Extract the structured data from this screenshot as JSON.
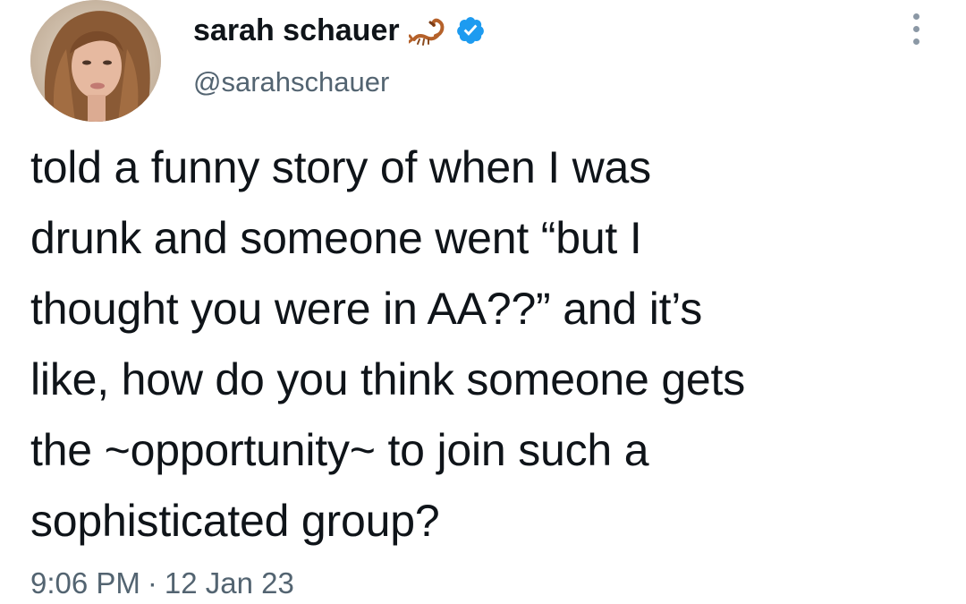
{
  "author": {
    "display_name": "sarah schauer",
    "handle": "@sarahschauer",
    "name_emoji": "scorpion-icon",
    "verified": true,
    "verified_color": "#1d9bf0"
  },
  "tweet": {
    "lines": [
      "told a funny story of when I was",
      "drunk and someone went “but I",
      "thought you were in AA??” and it’s",
      "like, how do you think someone gets",
      "the ~opportunity~ to join such a",
      "sophisticated group?"
    ]
  },
  "meta": {
    "time": "9:06 PM",
    "separator": "·",
    "date": "12 Jan 23"
  },
  "menu": {
    "icon": "more-options-icon"
  }
}
